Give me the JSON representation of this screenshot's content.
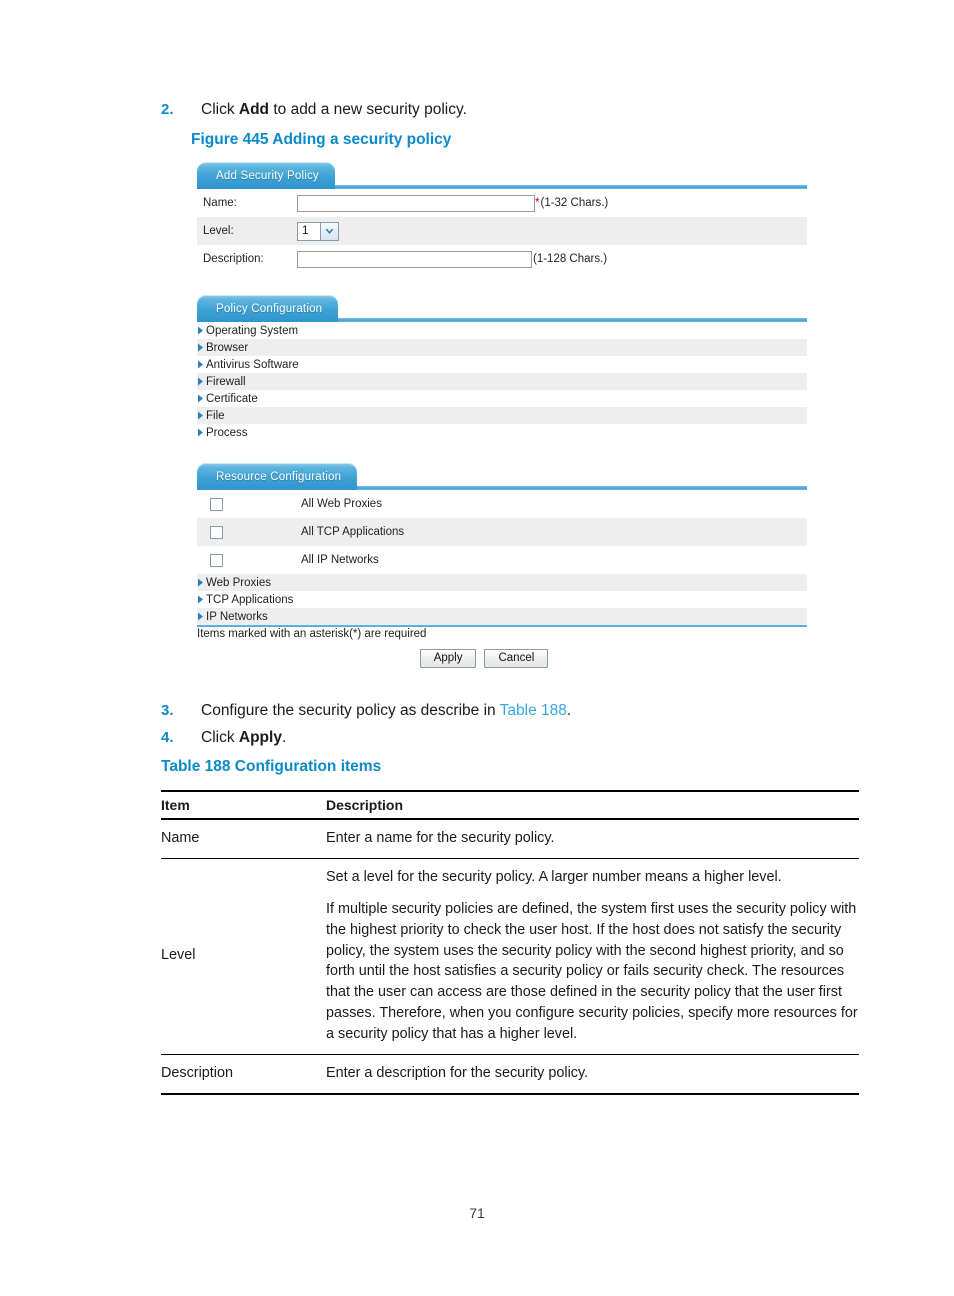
{
  "steps": {
    "step2": {
      "num": "2.",
      "pre": "Click ",
      "bold": "Add",
      "post": " to add a new security policy."
    },
    "step3": {
      "num": "3.",
      "pre": "Configure the security policy as describe in ",
      "link": "Table 188",
      "post": "."
    },
    "step4": {
      "num": "4.",
      "pre": "Click ",
      "bold": "Apply",
      "post": "."
    }
  },
  "figure": {
    "caption": "Figure 445 Adding a security policy",
    "panels": {
      "add_security_policy": {
        "tab_label": "Add Security Policy",
        "fields": [
          {
            "label": "Name:",
            "value": "",
            "required_mark": "*",
            "hint": "(1-32 Chars.)"
          },
          {
            "label": "Level:",
            "value": "1",
            "hint": ""
          },
          {
            "label": "Description:",
            "value": "",
            "hint": "(1-128 Chars.)"
          }
        ],
        "level_options": [
          "1"
        ]
      },
      "policy_configuration": {
        "tab_label": "Policy Configuration",
        "items": [
          "Operating System",
          "Browser",
          "Antivirus Software",
          "Firewall",
          "Certificate",
          "File",
          "Process"
        ]
      },
      "resource_configuration": {
        "tab_label": "Resource Configuration",
        "checkboxes": [
          {
            "label": "All Web Proxies",
            "checked": false
          },
          {
            "label": "All TCP Applications",
            "checked": false
          },
          {
            "label": "All IP Networks",
            "checked": false
          }
        ],
        "items": [
          "Web Proxies",
          "TCP Applications",
          "IP Networks"
        ]
      }
    },
    "required_note": "Items marked with an asterisk(*) are required",
    "buttons": {
      "apply": "Apply",
      "cancel": "Cancel"
    }
  },
  "table": {
    "caption": "Table 188 Configuration items",
    "headers": [
      "Item",
      "Description"
    ],
    "rows": [
      {
        "item": "Name",
        "paragraphs": [
          "Enter a name for the security policy."
        ]
      },
      {
        "item": "Level",
        "paragraphs": [
          "Set a level for the security policy. A larger number means a higher level.",
          "If multiple security policies are defined, the system first uses the security policy with the highest priority to check the user host. If the host does not satisfy the security policy, the system uses the security policy with the second highest priority, and so forth until the host satisfies a security policy or fails security check. The resources that the user can access are those defined in the security policy that the user first passes. Therefore, when you configure security policies, specify more resources for a security policy that has a higher level."
        ]
      },
      {
        "item": "Description",
        "paragraphs": [
          "Enter a description for the security policy."
        ]
      }
    ]
  },
  "page_number": "71",
  "colors": {
    "accent_blue": "#0b8ac9",
    "link_blue": "#35a8dd",
    "tab_blue": "#3fa2d4",
    "required_red": "#cc0000",
    "row_alt": "#eeeeee"
  }
}
